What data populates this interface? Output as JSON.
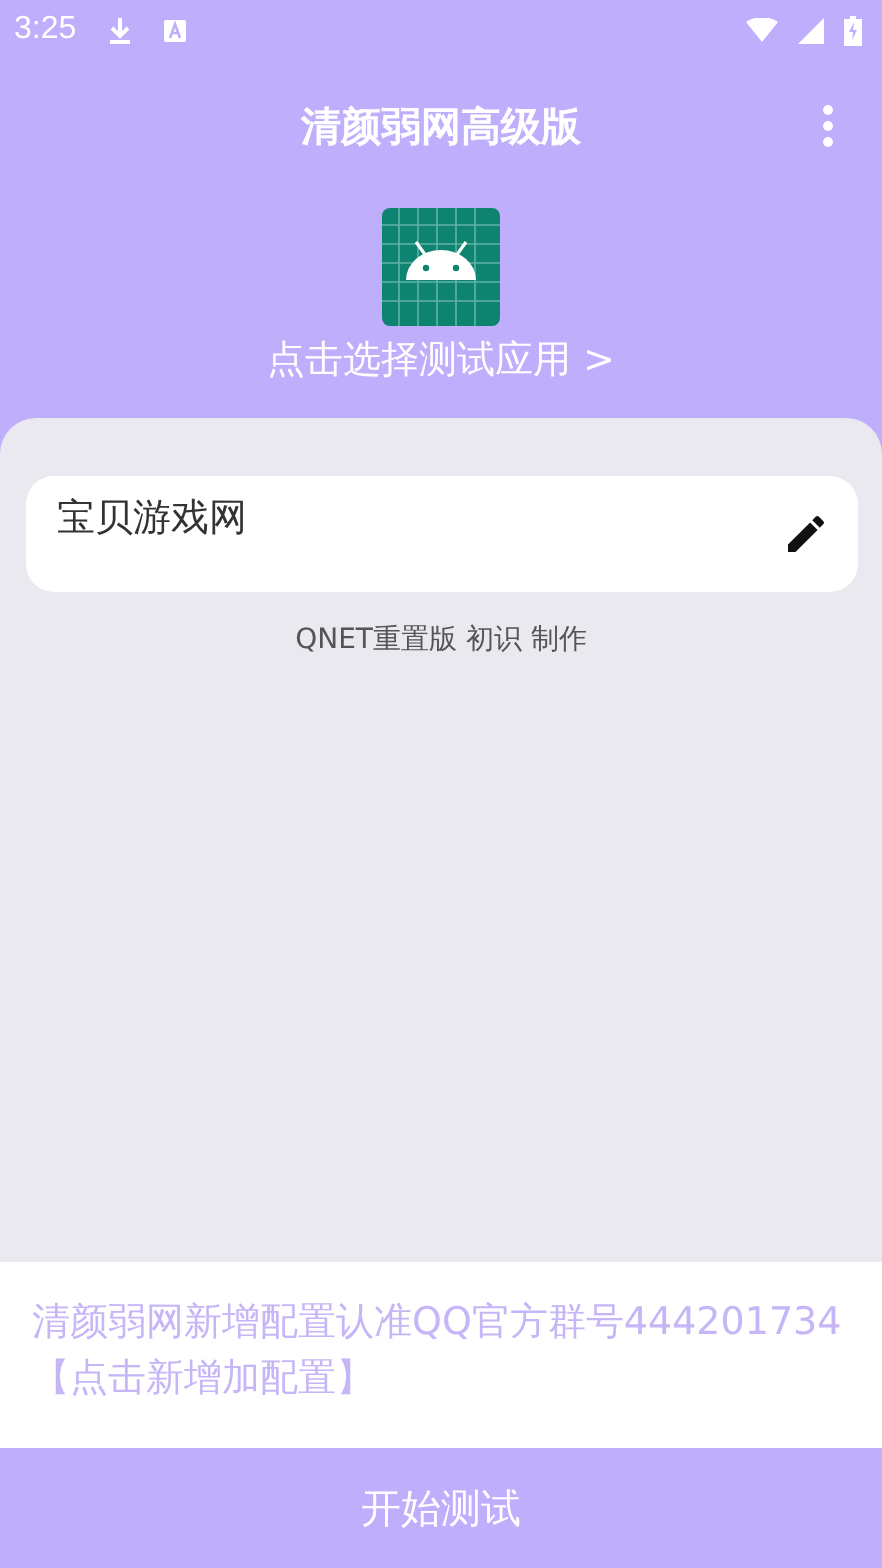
{
  "status_bar": {
    "time": "3:25"
  },
  "app_bar": {
    "title": "清颜弱网高级版"
  },
  "app_picker": {
    "label": "点击选择测试应用 >"
  },
  "config_field": {
    "value": "宝贝游戏网"
  },
  "credit": "QNET重置版 初识 制作",
  "notice": "清颜弱网新增配置认准QQ官方群号444201734【点击新增加配置】",
  "start_button": {
    "label": "开始测试"
  }
}
